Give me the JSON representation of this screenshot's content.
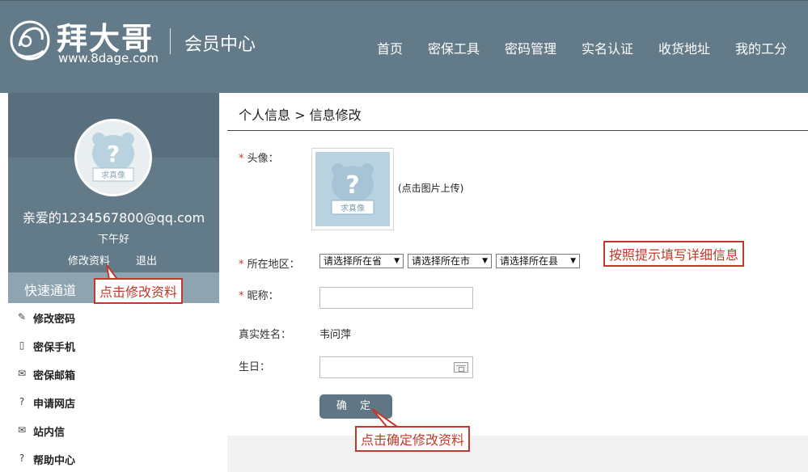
{
  "header": {
    "brand": "拜大哥",
    "url": "www.8dage.com",
    "section": "会员中心",
    "nav": [
      "首页",
      "密保工具",
      "密码管理",
      "实名认证",
      "收货地址",
      "我的工分"
    ]
  },
  "sidebar": {
    "email": "亲爱的1234567800@qq.com",
    "greeting": "下午好",
    "edit_profile": "修改资料",
    "logout": "退出",
    "quick_title": "快速通道",
    "quick_items": [
      {
        "label": "修改密码",
        "icon": "edit-icon"
      },
      {
        "label": "密保手机",
        "icon": "phone-icon"
      },
      {
        "label": "密保邮箱",
        "icon": "mail-icon"
      },
      {
        "label": "申请网店",
        "icon": "help-icon"
      },
      {
        "label": "站内信",
        "icon": "mail-icon"
      },
      {
        "label": "帮助中心",
        "icon": "help-icon"
      }
    ]
  },
  "main": {
    "breadcrumb": "个人信息 > 信息修改",
    "avatar_label": "头像：",
    "upload_hint": "(点击图片上传)",
    "region_label": "所在地区：",
    "province_placeholder": "请选择所在省",
    "city_placeholder": "请选择所在市",
    "county_placeholder": "请选择所在县",
    "nickname_label": "昵称：",
    "nickname_value": "",
    "realname_label": "真实姓名：",
    "realname_value": "韦问萍",
    "birthday_label": "生日：",
    "birthday_value": "",
    "confirm": "确 定",
    "avatar_badge": "求真像"
  },
  "callouts": {
    "edit_profile": "点击修改资料",
    "fill_info": "按照提示填写详细信息",
    "confirm": "点击确定修改资料"
  },
  "colors": {
    "header_bg": "#637a89",
    "quick_header_bg": "#8fa4b1",
    "button_bg": "#607684",
    "required": "#c0392b",
    "callout": "#c0392b"
  }
}
